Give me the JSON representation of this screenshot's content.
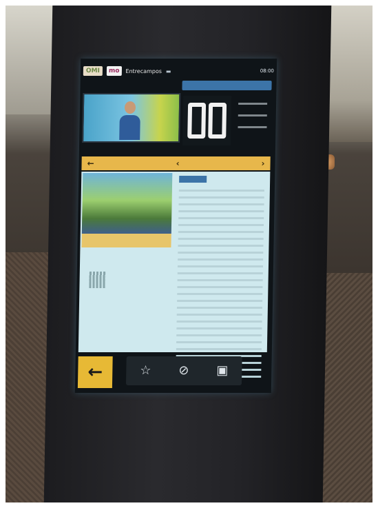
{
  "topbar": {
    "logo_a": "OMI",
    "logo_b": "mo",
    "app_title": "Entrecampos",
    "clock": "08:00"
  },
  "pager": {
    "back_arrow": "←",
    "prev": "‹",
    "next": "›"
  },
  "footer": {
    "back": "←",
    "dock": [
      {
        "icon": "star-icon",
        "glyph": "☆"
      },
      {
        "icon": "compass-icon",
        "glyph": "⊘"
      },
      {
        "icon": "bus-icon",
        "glyph": "▣"
      }
    ]
  },
  "colors": {
    "accent_yellow": "#e7b74b",
    "accent_blue": "#3c74a8",
    "screen_content": "#cfe9ee",
    "kiosk_body": "#232327"
  }
}
